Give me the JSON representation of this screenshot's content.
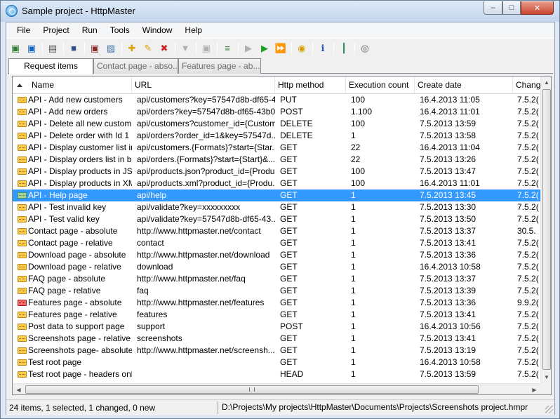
{
  "window": {
    "title": "Sample project - HttpMaster",
    "minimize": "–",
    "maximize": "□",
    "close": "✕"
  },
  "menu": [
    "File",
    "Project",
    "Run",
    "Tools",
    "Window",
    "Help"
  ],
  "toolbar": [
    {
      "icon": "new-request-icon",
      "glyph": "▣",
      "color": "#2e7d32"
    },
    {
      "icon": "new-request-copy-icon",
      "glyph": "▣",
      "color": "#1565c0"
    },
    {
      "sep": true
    },
    {
      "icon": "project-properties-icon",
      "glyph": "▤",
      "color": "#555555"
    },
    {
      "sep": true
    },
    {
      "icon": "save-icon",
      "glyph": "■",
      "color": "#2d4e8a"
    },
    {
      "sep": true
    },
    {
      "icon": "export-icon",
      "glyph": "▣",
      "color": "#8a2d2d"
    },
    {
      "icon": "image-icon",
      "glyph": "▨",
      "color": "#3a6ea5"
    },
    {
      "sep": true
    },
    {
      "icon": "add-item-icon",
      "glyph": "✚",
      "color": "#e0a000"
    },
    {
      "icon": "edit-item-icon",
      "glyph": "✎",
      "color": "#e0a000"
    },
    {
      "icon": "delete-item-icon",
      "glyph": "✖",
      "color": "#c62828"
    },
    {
      "sep": true
    },
    {
      "icon": "disabled-action-icon",
      "glyph": "▼",
      "color": "#b0b0b0"
    },
    {
      "sep": true
    },
    {
      "icon": "disabled-action-2-icon",
      "glyph": "▣",
      "color": "#b0b0b0"
    },
    {
      "sep": true
    },
    {
      "icon": "tree-view-icon",
      "glyph": "≡",
      "color": "#2e7d32"
    },
    {
      "sep": true
    },
    {
      "icon": "step-disabled-icon",
      "glyph": "▶",
      "color": "#b0b0b0"
    },
    {
      "icon": "run-icon",
      "glyph": "▶",
      "color": "#1fa01f"
    },
    {
      "icon": "run-all-icon",
      "glyph": "⏩",
      "color": "#1fa01f"
    },
    {
      "sep": true
    },
    {
      "icon": "stop-icon",
      "glyph": "◉",
      "color": "#d8a000"
    },
    {
      "sep": true
    },
    {
      "icon": "info-icon",
      "glyph": "ℹ",
      "color": "#1e4fb5"
    },
    {
      "sep": true
    },
    {
      "icon": "statistics-icon",
      "glyph": "┃",
      "color": "#2e8b57"
    },
    {
      "sep": true
    },
    {
      "icon": "signal-icon",
      "glyph": "◎",
      "color": "#555555"
    }
  ],
  "tabs": [
    {
      "label": "Request items",
      "active": true
    },
    {
      "label": "Contact page - abso...",
      "active": false
    },
    {
      "label": "Features page - ab...*",
      "active": false
    }
  ],
  "columns": [
    "Name",
    "URL",
    "Http method",
    "Execution count",
    "Create date",
    "Chang"
  ],
  "rows": [
    {
      "name": "API - Add new customers",
      "url": "api/customers?key=57547d8b-df65-4...",
      "method": "PUT",
      "count": "100",
      "created": "16.4.2013 11:05",
      "changed": "7.5.2(",
      "icon": "normal"
    },
    {
      "name": "API - Add new orders",
      "url": "api/orders?key=57547d8b-df65-43b0...",
      "method": "POST",
      "count": "1.100",
      "created": "16.4.2013 11:01",
      "changed": "7.5.2(",
      "icon": "normal"
    },
    {
      "name": "API - Delete all new customers",
      "url": "api/customers?customer_id={Custom...",
      "method": "DELETE",
      "count": "100",
      "created": "7.5.2013 13:59",
      "changed": "7.5.2(",
      "icon": "normal"
    },
    {
      "name": "API - Delete order with Id 1",
      "url": "api/orders?order_id=1&key=57547d...",
      "method": "DELETE",
      "count": "1",
      "created": "7.5.2013 13:58",
      "changed": "7.5.2(",
      "icon": "normal"
    },
    {
      "name": "API - Display customer list in...",
      "url": "api/customers.{Formats}?start={Star...",
      "method": "GET",
      "count": "22",
      "created": "16.4.2013 11:04",
      "changed": "7.5.2(",
      "icon": "normal"
    },
    {
      "name": "API - Display orders list in b...",
      "url": "api/orders.{Formats}?start={Start}&...",
      "method": "GET",
      "count": "22",
      "created": "7.5.2013 13:26",
      "changed": "7.5.2(",
      "icon": "normal"
    },
    {
      "name": "API - Display products in JSON",
      "url": "api/products.json?product_id={Produ...",
      "method": "GET",
      "count": "100",
      "created": "7.5.2013 13:47",
      "changed": "7.5.2(",
      "icon": "normal"
    },
    {
      "name": "API - Display products in XML",
      "url": "api/products.xml?product_id={Produ...",
      "method": "GET",
      "count": "100",
      "created": "16.4.2013 11:01",
      "changed": "7.5.2(",
      "icon": "normal"
    },
    {
      "name": "API - Help page",
      "url": "api/help",
      "method": "GET",
      "count": "1",
      "created": "7.5.2013 13:45",
      "changed": "7.5.2(",
      "icon": "green",
      "selected": true
    },
    {
      "name": "API - Test invalid key",
      "url": "api/validate?key=xxxxxxxxx",
      "method": "GET",
      "count": "1",
      "created": "7.5.2013 13:30",
      "changed": "7.5.2(",
      "icon": "normal"
    },
    {
      "name": "API - Test valid key",
      "url": "api/validate?key=57547d8b-df65-43...",
      "method": "GET",
      "count": "1",
      "created": "7.5.2013 13:50",
      "changed": "7.5.2(",
      "icon": "normal"
    },
    {
      "name": "Contact page - absolute",
      "url": "http://www.httpmaster.net/contact",
      "method": "GET",
      "count": "1",
      "created": "7.5.2013 13:37",
      "changed": "30.5.",
      "icon": "normal"
    },
    {
      "name": "Contact page - relative",
      "url": "contact",
      "method": "GET",
      "count": "1",
      "created": "7.5.2013 13:41",
      "changed": "7.5.2(",
      "icon": "normal"
    },
    {
      "name": "Download page - absolute",
      "url": "http://www.httpmaster.net/download",
      "method": "GET",
      "count": "1",
      "created": "7.5.2013 13:36",
      "changed": "7.5.2(",
      "icon": "normal"
    },
    {
      "name": "Download page - relative",
      "url": "download",
      "method": "GET",
      "count": "1",
      "created": "16.4.2013 10:58",
      "changed": "7.5.2(",
      "icon": "normal"
    },
    {
      "name": "FAQ page - absolute",
      "url": "http://www.httpmaster.net/faq",
      "method": "GET",
      "count": "1",
      "created": "7.5.2013 13:37",
      "changed": "7.5.2(",
      "icon": "normal"
    },
    {
      "name": "FAQ page - relative",
      "url": "faq",
      "method": "GET",
      "count": "1",
      "created": "7.5.2013 13:39",
      "changed": "7.5.2(",
      "icon": "normal"
    },
    {
      "name": "Features page - absolute",
      "url": "http://www.httpmaster.net/features",
      "method": "GET",
      "count": "1",
      "created": "7.5.2013 13:36",
      "changed": "9.9.2(",
      "icon": "red"
    },
    {
      "name": "Features page - relative",
      "url": "features",
      "method": "GET",
      "count": "1",
      "created": "7.5.2013 13:41",
      "changed": "7.5.2(",
      "icon": "normal"
    },
    {
      "name": "Post data to support page",
      "url": "support",
      "method": "POST",
      "count": "1",
      "created": "16.4.2013 10:56",
      "changed": "7.5.2(",
      "icon": "normal"
    },
    {
      "name": "Screenshots page - relative",
      "url": "screenshots",
      "method": "GET",
      "count": "1",
      "created": "7.5.2013 13:41",
      "changed": "7.5.2(",
      "icon": "normal"
    },
    {
      "name": "Screenshots page- absolute",
      "url": "http://www.httpmaster.net/screensh...",
      "method": "GET",
      "count": "1",
      "created": "7.5.2013 13:19",
      "changed": "7.5.2(",
      "icon": "normal"
    },
    {
      "name": "Test root page",
      "url": "",
      "method": "GET",
      "count": "1",
      "created": "16.4.2013 10:58",
      "changed": "7.5.2(",
      "icon": "normal"
    },
    {
      "name": "Test root page - headers only",
      "url": "",
      "method": "HEAD",
      "count": "1",
      "created": "7.5.2013 13:59",
      "changed": "7.5.2(",
      "icon": "normal"
    }
  ],
  "status": {
    "summary": "24 items, 1 selected, 1 changed, 0 new",
    "path": "D:\\Projects\\My projects\\HttpMaster\\Documents\\Projects\\Screenshots project.hmpr"
  },
  "colors": {
    "selection": "#3399ff",
    "close_button": "#c8452e"
  }
}
